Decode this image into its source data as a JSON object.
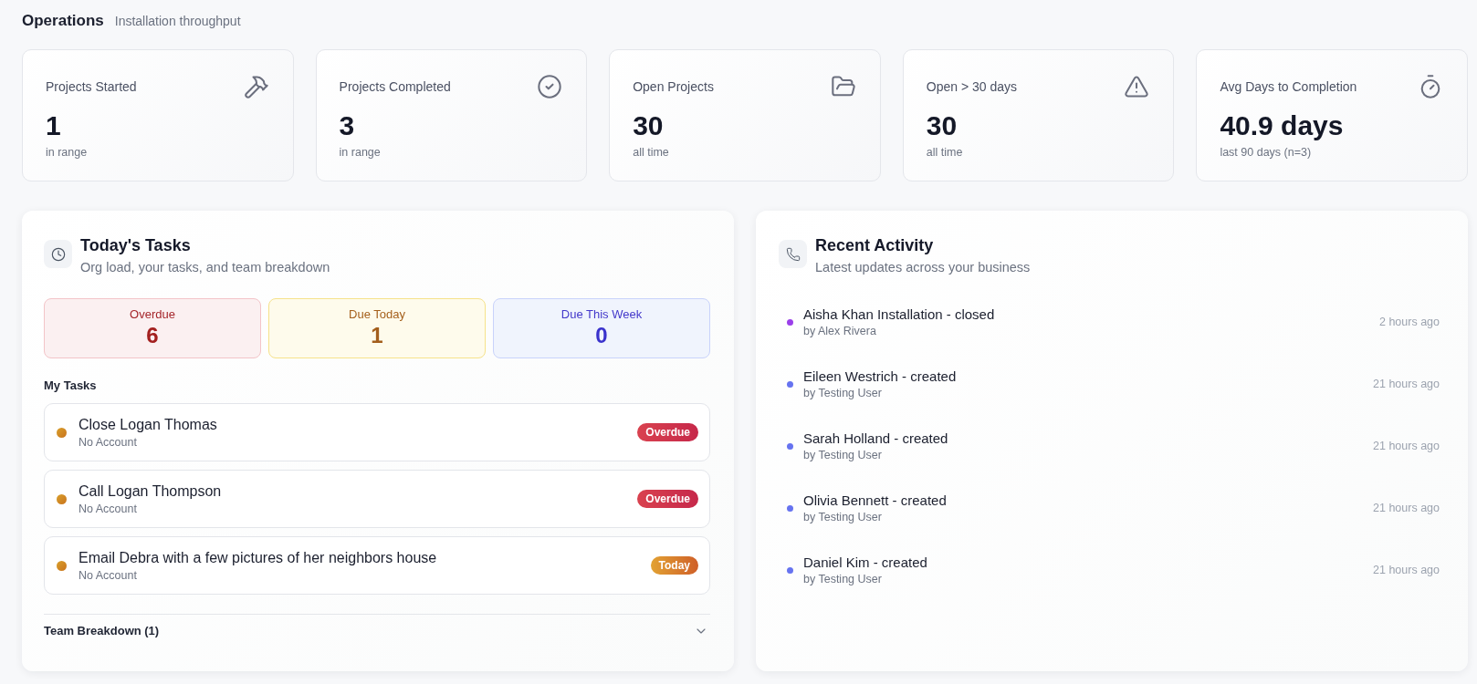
{
  "header": {
    "title": "Operations",
    "subtitle": "Installation throughput"
  },
  "stats": [
    {
      "label": "Projects Started",
      "value": "1",
      "note": "in range"
    },
    {
      "label": "Projects Completed",
      "value": "3",
      "note": "in range"
    },
    {
      "label": "Open Projects",
      "value": "30",
      "note": "all time"
    },
    {
      "label": "Open > 30 days",
      "value": "30",
      "note": "all time"
    },
    {
      "label": "Avg Days to Completion",
      "value": "40.9 days",
      "note": "last 90 days (n=3)"
    }
  ],
  "tasks_panel": {
    "title": "Today's Tasks",
    "subtitle": "Org load, your tasks, and team breakdown",
    "summary": [
      {
        "kind": "overdue",
        "label": "Overdue",
        "count": "6"
      },
      {
        "kind": "today",
        "label": "Due Today",
        "count": "1"
      },
      {
        "kind": "week",
        "label": "Due This Week",
        "count": "0"
      }
    ],
    "my_tasks_heading": "My Tasks",
    "tasks": [
      {
        "title": "Close Logan Thomas",
        "account": "No Account",
        "badge": {
          "kind": "overdue",
          "label": "Overdue"
        }
      },
      {
        "title": "Call Logan Thompson",
        "account": "No Account",
        "badge": {
          "kind": "overdue",
          "label": "Overdue"
        }
      },
      {
        "title": "Email Debra with a few pictures of her neighbors house",
        "account": "No Account",
        "badge": {
          "kind": "today",
          "label": "Today"
        }
      }
    ],
    "team_breakdown": {
      "label": "Team Breakdown (1)",
      "expanded": false
    }
  },
  "activity_panel": {
    "title": "Recent Activity",
    "subtitle": "Latest updates across your business",
    "items": [
      {
        "title": "Aisha Khan Installation - closed",
        "by": "by Alex Rivera",
        "time": "2 hours ago",
        "color": "#9b3fea"
      },
      {
        "title": "Eileen Westrich - created",
        "by": "by Testing User",
        "time": "21 hours ago",
        "color": "#6673f0"
      },
      {
        "title": "Sarah Holland - created",
        "by": "by Testing User",
        "time": "21 hours ago",
        "color": "#6673f0"
      },
      {
        "title": "Olivia Bennett - created",
        "by": "by Testing User",
        "time": "21 hours ago",
        "color": "#6673f0"
      },
      {
        "title": "Daniel Kim - created",
        "by": "by Testing User",
        "time": "21 hours ago",
        "color": "#6673f0"
      }
    ]
  }
}
